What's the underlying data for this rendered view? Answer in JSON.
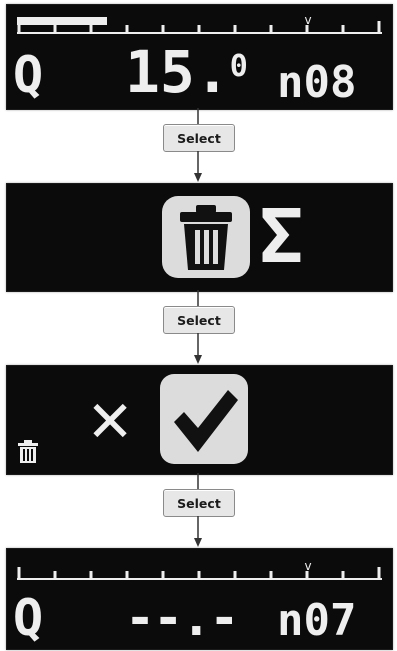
{
  "screen1": {
    "quantity_letter": "Q",
    "value_main": "15.",
    "value_decimal": "0",
    "code_letter": "n",
    "code_number": "08"
  },
  "step1": {
    "label": "Select"
  },
  "screen2": {
    "sum_symbol": "Σ"
  },
  "step2": {
    "label": "Select"
  },
  "screen3": {
    "cancel_symbol": "✕"
  },
  "step3": {
    "label": "Select"
  },
  "screen4": {
    "quantity_letter": "Q",
    "value_main": "--.-",
    "code_letter": "n",
    "code_number": "07"
  },
  "colors": {
    "lcd_bg": "#0b0b0b",
    "lcd_fg": "#eeeeee",
    "button_bg": "#e7e7e7"
  }
}
